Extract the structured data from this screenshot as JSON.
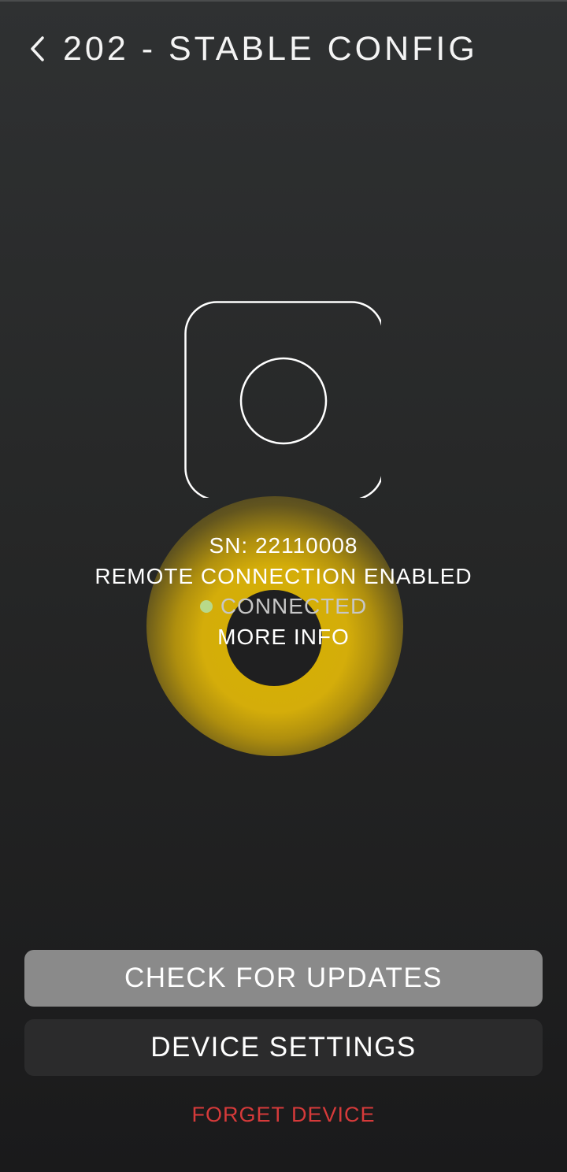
{
  "header": {
    "back_icon": "chevron-left-icon",
    "title": "202 - STABLE CONFIG"
  },
  "device": {
    "icon": "device-square-icon",
    "serial": "SN: 22110008",
    "remote": "REMOTE CONNECTION ENABLED",
    "status": "CONNECTED",
    "status_color": "#b8d98a",
    "more_info": "MORE INFO"
  },
  "actions": {
    "check_updates": "CHECK FOR UPDATES",
    "device_settings": "DEVICE SETTINGS",
    "forget_device": "FORGET DEVICE",
    "forget_color": "#d63a3a"
  }
}
